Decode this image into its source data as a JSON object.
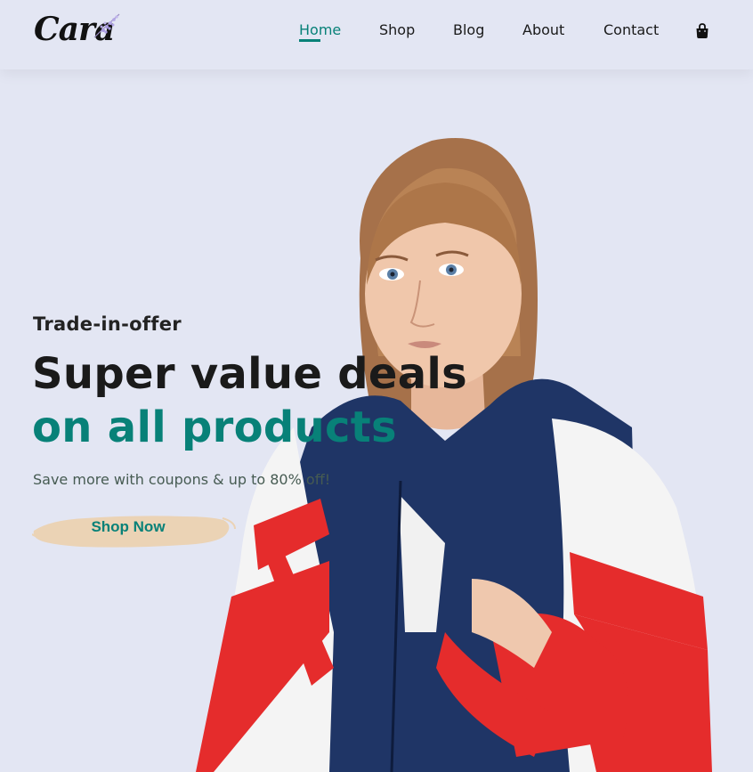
{
  "brand": {
    "logo_text": "Cara"
  },
  "nav": {
    "items": [
      {
        "label": "Home",
        "active": true
      },
      {
        "label": "Shop",
        "active": false
      },
      {
        "label": "Blog",
        "active": false
      },
      {
        "label": "About",
        "active": false
      },
      {
        "label": "Contact",
        "active": false
      }
    ],
    "cart_icon": "shopping-bag-icon"
  },
  "hero": {
    "tagline": "Trade-in-offer",
    "headline_line1": "Super value deals",
    "headline_line2": "on all products",
    "subtext": "Save more with coupons & up to 80% off!",
    "cta_label": "Shop Now",
    "image": "model-in-windbreaker-jacket"
  },
  "colors": {
    "background": "#e3e6f3",
    "accent": "#088178",
    "text_dark": "#1a1a1a",
    "button_brush": "#ebd3b5"
  }
}
